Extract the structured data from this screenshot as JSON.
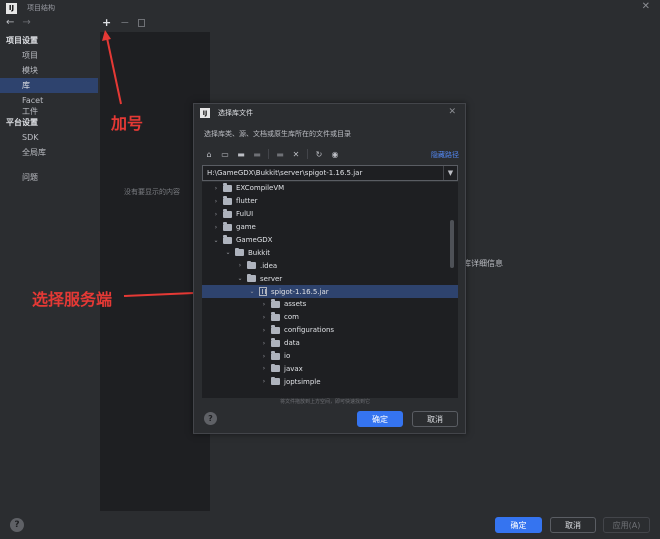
{
  "window": {
    "title": "项目结构",
    "close": "✕"
  },
  "nav": {
    "back": "←",
    "forward": "→"
  },
  "sidebar": {
    "section1": "项目设置",
    "items1": [
      "项目",
      "模块",
      "库",
      "Facet",
      "工件"
    ],
    "section2": "平台设置",
    "items2": [
      "SDK",
      "全局库"
    ],
    "items3": [
      "问题"
    ]
  },
  "middle": {
    "add": "+",
    "remove": "−",
    "empty_text": "没有要显示的内容"
  },
  "right_hint": "库详细信息",
  "annotations": {
    "plus": "加号",
    "server": "选择服务端",
    "color": "#e53935"
  },
  "dialog": {
    "title": "选择库文件",
    "close": "✕",
    "description": "选择库类、源、文档或原生库所在的文件或目录",
    "hide_path": "隐藏路径",
    "path": "H:\\GameGDX\\Bukkit\\server\\spigot-1.16.5.jar",
    "drag_hint": "将文件拖放到上方空间，即可快速找到它",
    "ok": "确定",
    "cancel": "取消",
    "help": "?"
  },
  "tree": [
    {
      "name": "EXCompileVM",
      "depth": 0,
      "expanded": false,
      "type": "folder"
    },
    {
      "name": "flutter",
      "depth": 0,
      "expanded": false,
      "type": "folder"
    },
    {
      "name": "FulUI",
      "depth": 0,
      "expanded": false,
      "type": "folder"
    },
    {
      "name": "game",
      "depth": 0,
      "expanded": false,
      "type": "folder"
    },
    {
      "name": "GameGDX",
      "depth": 0,
      "expanded": true,
      "type": "folder"
    },
    {
      "name": "Bukkit",
      "depth": 1,
      "expanded": true,
      "type": "folder"
    },
    {
      "name": ".idea",
      "depth": 2,
      "expanded": false,
      "type": "folder"
    },
    {
      "name": "server",
      "depth": 2,
      "expanded": true,
      "type": "folder"
    },
    {
      "name": "spigot-1.16.5.jar",
      "depth": 3,
      "expanded": true,
      "type": "jar",
      "selected": true
    },
    {
      "name": "assets",
      "depth": 4,
      "expanded": false,
      "type": "folder"
    },
    {
      "name": "com",
      "depth": 4,
      "expanded": false,
      "type": "folder"
    },
    {
      "name": "configurations",
      "depth": 4,
      "expanded": false,
      "type": "folder"
    },
    {
      "name": "data",
      "depth": 4,
      "expanded": false,
      "type": "folder"
    },
    {
      "name": "io",
      "depth": 4,
      "expanded": false,
      "type": "folder"
    },
    {
      "name": "javax",
      "depth": 4,
      "expanded": false,
      "type": "folder"
    },
    {
      "name": "joptsimple",
      "depth": 4,
      "expanded": false,
      "type": "folder"
    }
  ],
  "footer": {
    "ok": "确定",
    "cancel": "取消",
    "apply": "应用(A)",
    "help": "?"
  }
}
